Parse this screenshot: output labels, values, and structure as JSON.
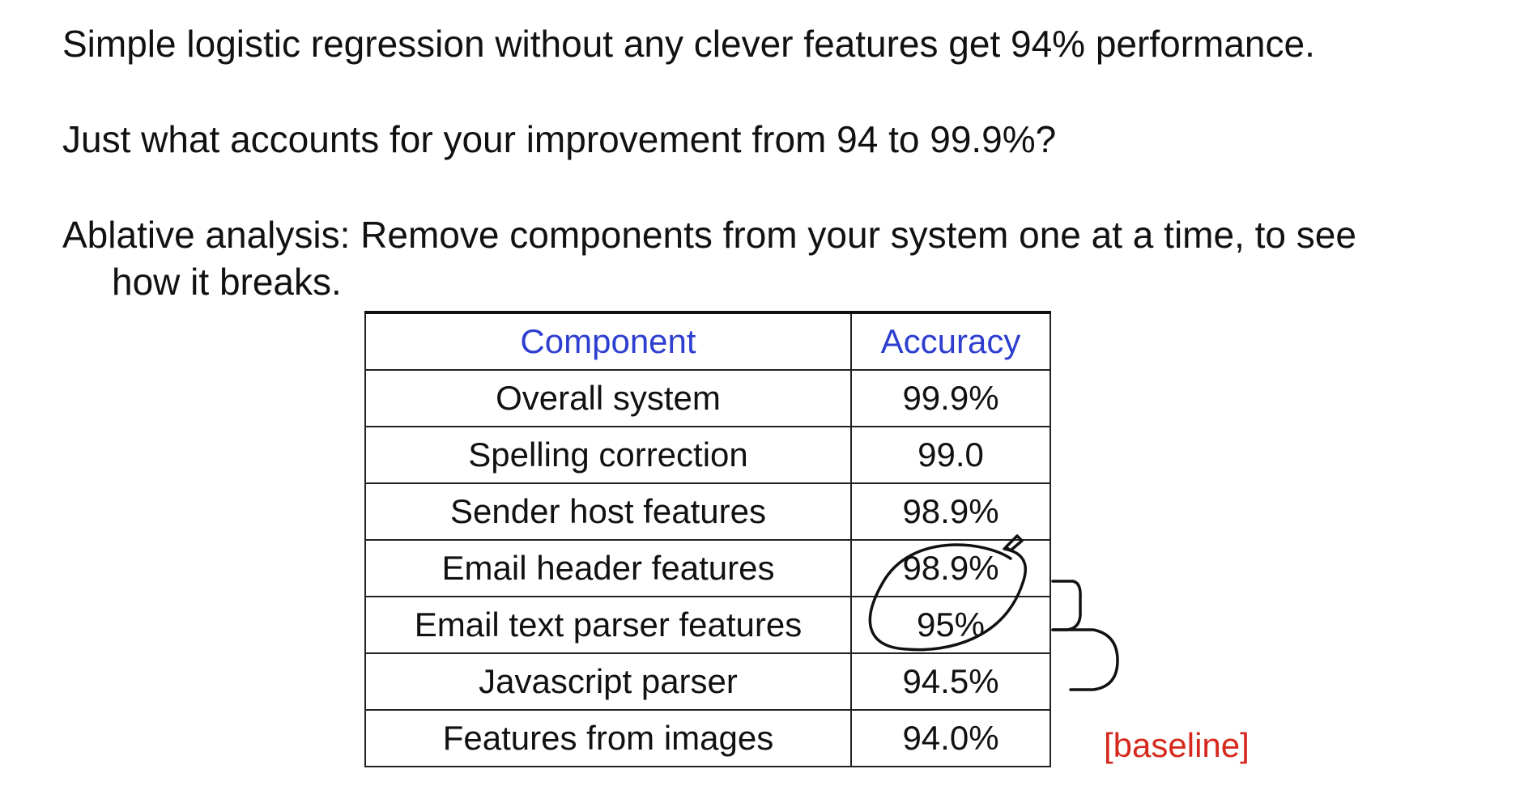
{
  "text": {
    "line1": "Simple logistic regression without any clever features get 94% performance.",
    "line2": "Just what accounts for your improvement from 94 to 99.9%?",
    "line3": "Ablative analysis: Remove components from your system one at a time, to see",
    "line3_cont": "how it breaks."
  },
  "table": {
    "headers": [
      "Component",
      "Accuracy"
    ],
    "rows": [
      [
        "Overall system",
        "99.9%"
      ],
      [
        "Spelling correction",
        "99.0"
      ],
      [
        "Sender host features",
        "98.9%"
      ],
      [
        "Email header features",
        "98.9%"
      ],
      [
        "Email text parser features",
        "95%"
      ],
      [
        "Javascript parser",
        "94.5%"
      ],
      [
        "Features from images",
        "94.0%"
      ]
    ]
  },
  "baseline_label": "[baseline]",
  "colors": {
    "header_text": "#2e3fd0",
    "baseline_text": "#d6281c",
    "ink": "#111111"
  }
}
